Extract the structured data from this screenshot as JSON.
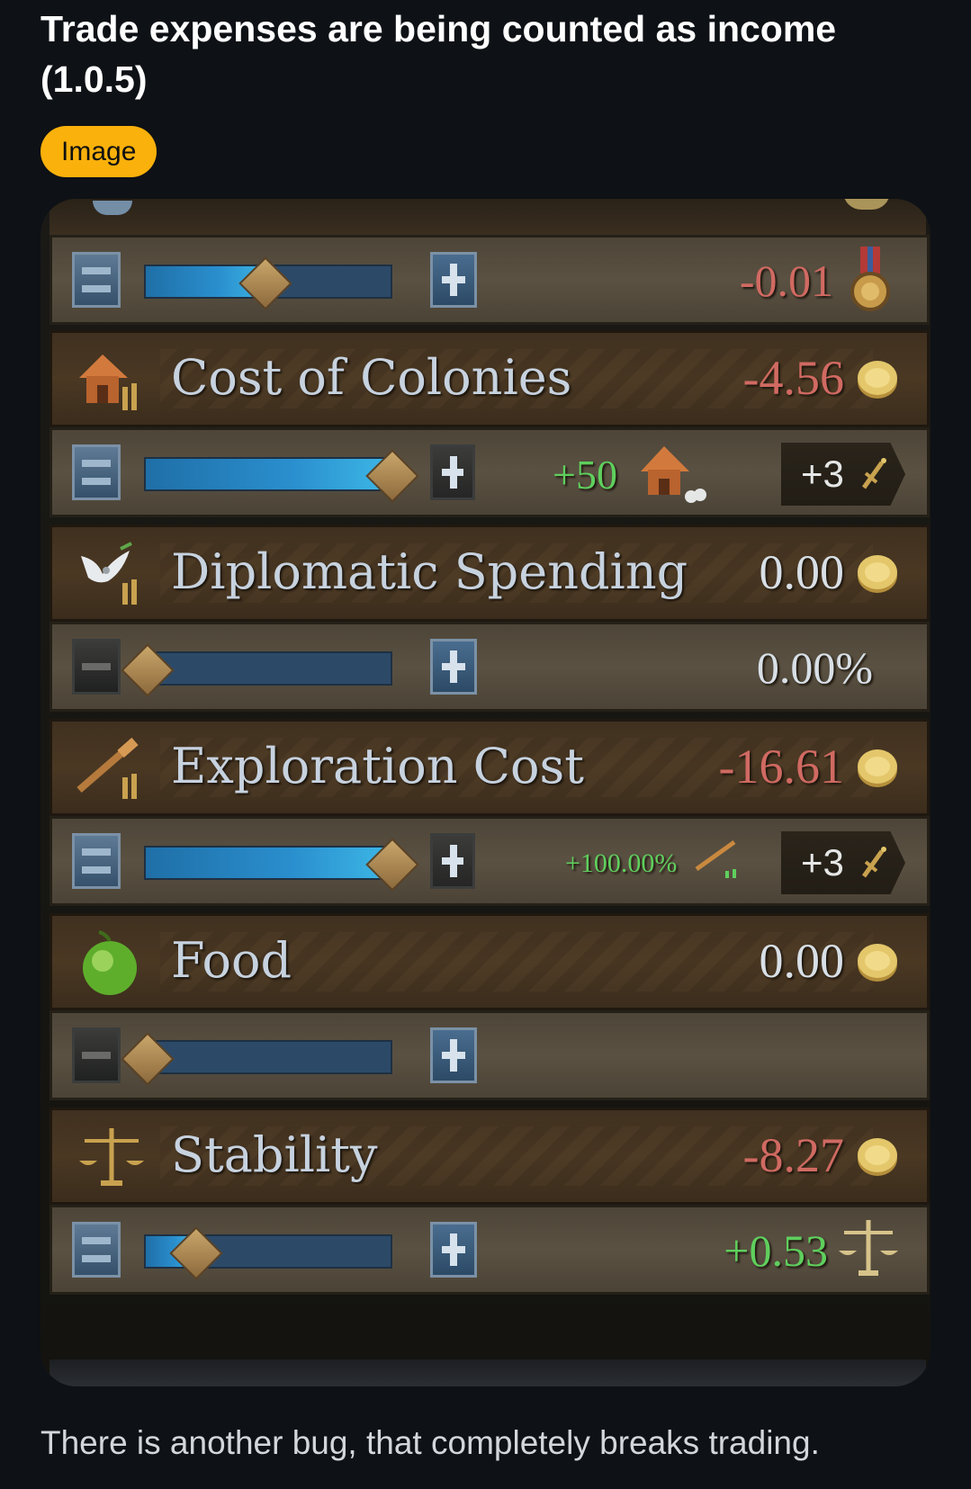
{
  "post": {
    "title": "Trade expenses are being counted as income (1.0.5)",
    "flair": "Image",
    "body": "There is another bug, that completely breaks trading."
  },
  "colors": {
    "negative": "#d06a62",
    "neutral": "#d8dfe6",
    "positive": "#5fcf5d",
    "flair_bg": "#fbb10b"
  },
  "budget": {
    "cutoff_header": {
      "value_fragment": ""
    },
    "cutoff_slider": {
      "fill_percent": 50,
      "value": "-0.01",
      "icon": "medal-icon"
    },
    "rows": [
      {
        "id": "colonies",
        "title": "Cost of Colonies",
        "value": "-4.56",
        "value_tone": "negative",
        "icon": "colony-house-icon",
        "slider_fill_percent": 100,
        "modifier": "+50",
        "modifier_icon": "colony-house-icon",
        "badge": "+3",
        "badge_icon": "sword-icon"
      },
      {
        "id": "diplomatic",
        "title": "Diplomatic Spending",
        "value": "0.00",
        "value_tone": "neutral",
        "icon": "dove-icon",
        "slider_fill_percent": 0,
        "slider_value": "0.00%"
      },
      {
        "id": "exploration",
        "title": "Exploration Cost",
        "value": "-16.61",
        "value_tone": "negative",
        "icon": "spyglass-icon",
        "slider_fill_percent": 100,
        "modifier": "+100.00%",
        "modifier_icon": "spyglass-icon",
        "badge": "+3",
        "badge_icon": "sword-icon"
      },
      {
        "id": "food",
        "title": "Food",
        "value": "0.00",
        "value_tone": "neutral",
        "icon": "apple-icon",
        "slider_fill_percent": 0
      },
      {
        "id": "stability",
        "title": "Stability",
        "value": "-8.27",
        "value_tone": "negative",
        "icon": "scales-icon",
        "slider_fill_percent": 20,
        "slider_value": "+0.53",
        "slider_value_icon": "scales-icon"
      }
    ]
  }
}
